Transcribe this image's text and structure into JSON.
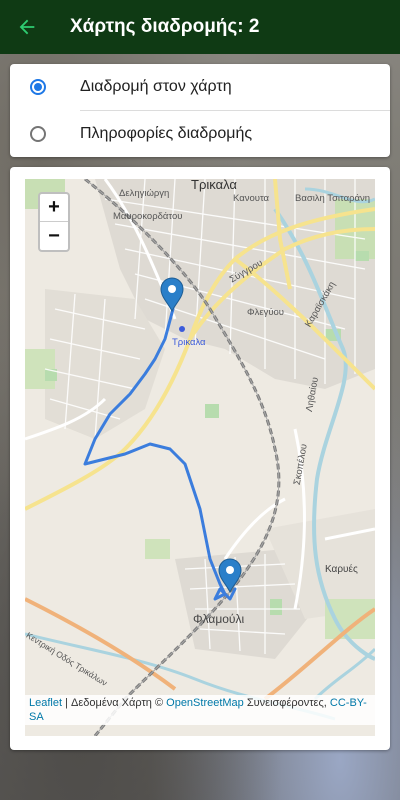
{
  "appbar": {
    "title": "Χάρτης διαδρομής: 2",
    "back_icon": "arrow-back-icon",
    "back_color": "#2ecc71",
    "background": "#0f3a14"
  },
  "view_options": {
    "selected": 0,
    "items": [
      {
        "label": "Διαδρομή στον χάρτη"
      },
      {
        "label": "Πληροφορίες διαδρομής"
      }
    ],
    "accent": "#1e78e6"
  },
  "map": {
    "zoom_in_label": "+",
    "zoom_out_label": "−",
    "city_label": "Τρικαλα",
    "station_label": "Τρικαλα",
    "place_labels": {
      "flamouli": "Φλαμούλι",
      "karyes": "Καρυές",
      "deligiorgi": "Δεληγιώργη",
      "mavrokordatou": "Μαυροκορδάτου",
      "kanouta": "Κανουτα",
      "vasilis": "Βασιλη Τσιταράνη",
      "syggrou": "Σύγγρου",
      "flegyou": "Φλεγύου",
      "karaiskaki": "Καραϊσκάκη",
      "skopelou": "Σκοπέλου",
      "lithaiou": "Ληθαίου",
      "kentriki": "Κεντρική Οδός Τρικάλων"
    },
    "route_color": "#3b7ddd",
    "marker_color": "#2a7fc9"
  },
  "attribution": {
    "leaflet": "Leaflet",
    "sep": " | Δεδομένα Χάρτη © ",
    "osm": "OpenStreetMap",
    "contrib": " Συνεισφέροντες, ",
    "license": "CC-BY-SA"
  }
}
